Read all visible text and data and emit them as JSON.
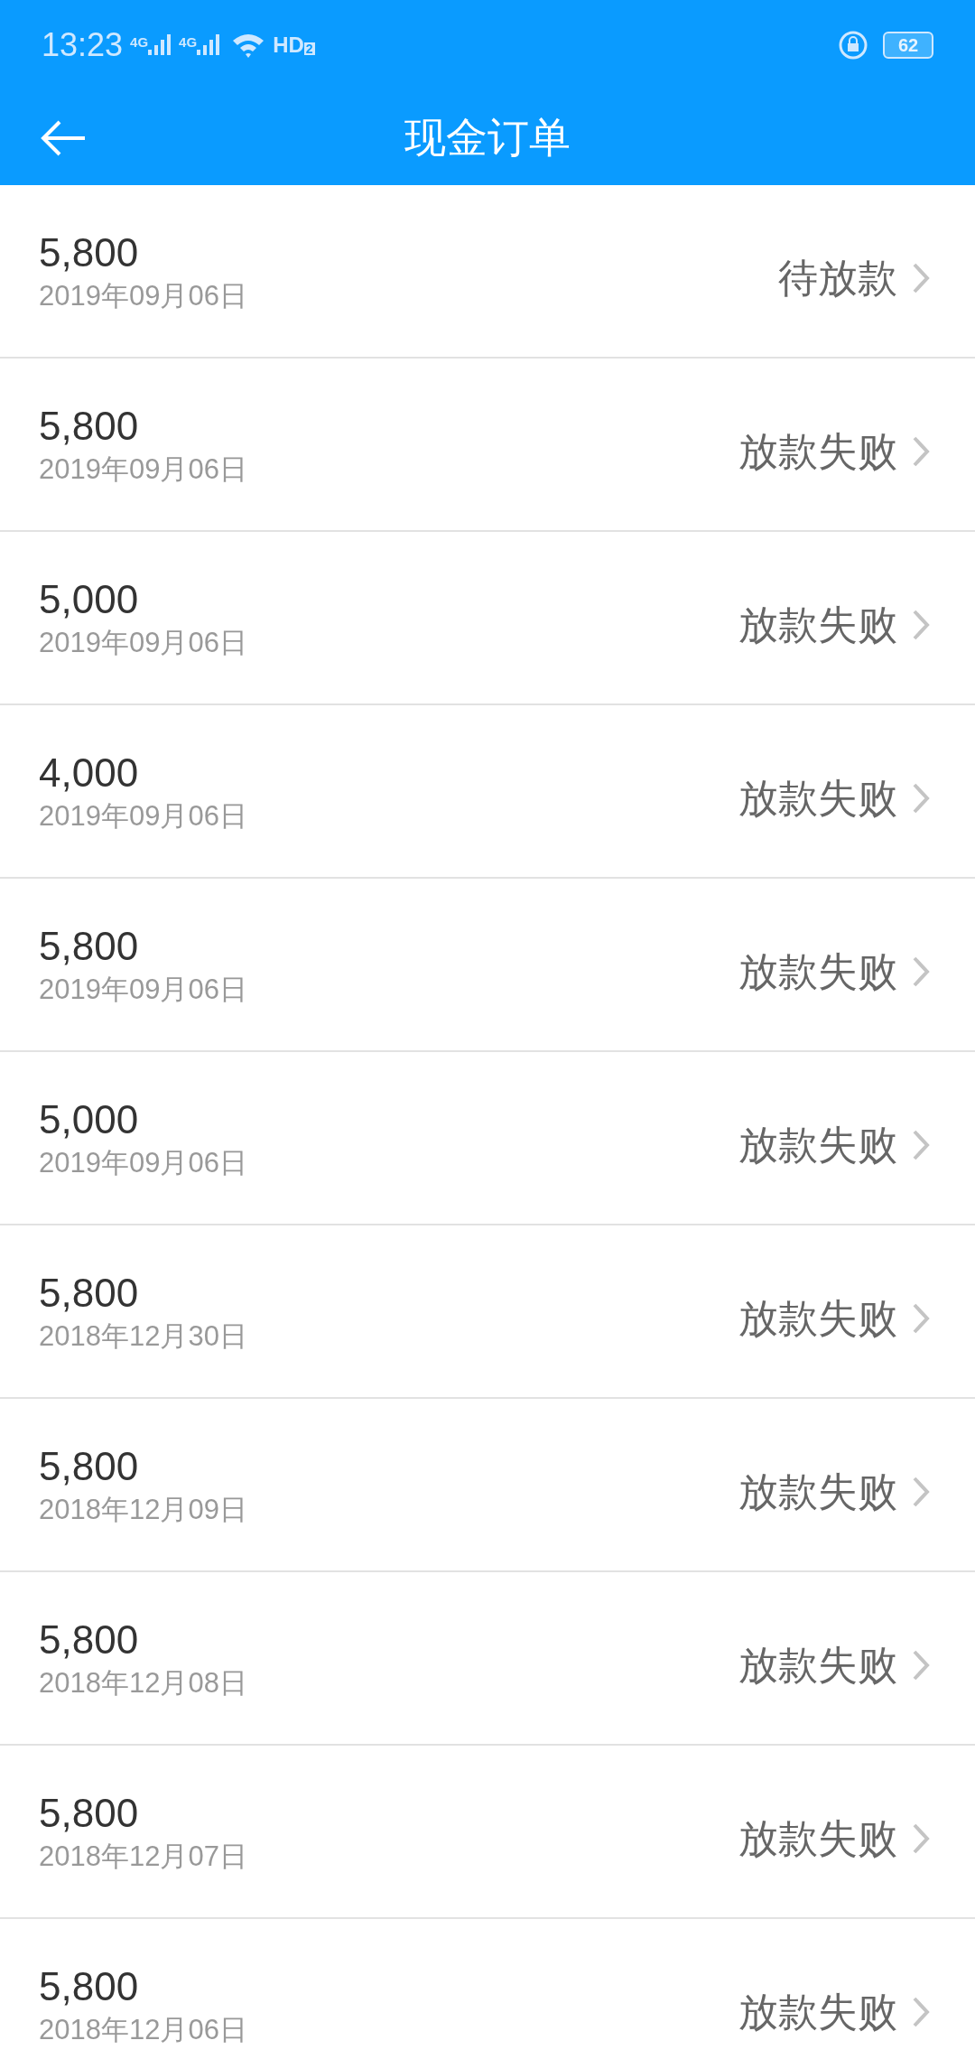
{
  "status_bar": {
    "time": "13:23",
    "signal_1": "4G",
    "signal_2": "4G",
    "hd": "HD",
    "hd_index": "2",
    "battery": "62"
  },
  "header": {
    "title": "现金订单"
  },
  "orders": [
    {
      "amount": "5,800",
      "date": "2019年09月06日",
      "status": "待放款"
    },
    {
      "amount": "5,800",
      "date": "2019年09月06日",
      "status": "放款失败"
    },
    {
      "amount": "5,000",
      "date": "2019年09月06日",
      "status": "放款失败"
    },
    {
      "amount": "4,000",
      "date": "2019年09月06日",
      "status": "放款失败"
    },
    {
      "amount": "5,800",
      "date": "2019年09月06日",
      "status": "放款失败"
    },
    {
      "amount": "5,000",
      "date": "2019年09月06日",
      "status": "放款失败"
    },
    {
      "amount": "5,800",
      "date": "2018年12月30日",
      "status": "放款失败"
    },
    {
      "amount": "5,800",
      "date": "2018年12月09日",
      "status": "放款失败"
    },
    {
      "amount": "5,800",
      "date": "2018年12月08日",
      "status": "放款失败"
    },
    {
      "amount": "5,800",
      "date": "2018年12月07日",
      "status": "放款失败"
    },
    {
      "amount": "5,800",
      "date": "2018年12月06日",
      "status": "放款失败"
    }
  ]
}
